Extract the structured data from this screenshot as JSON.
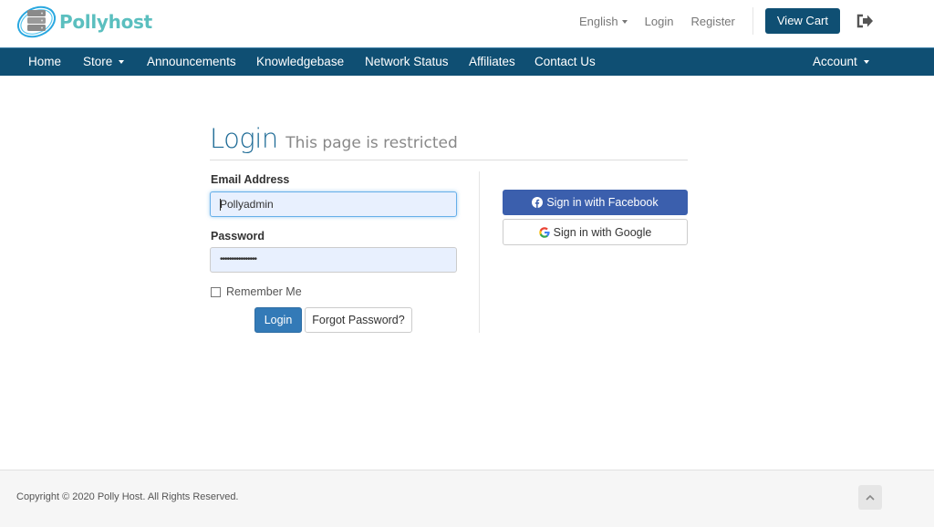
{
  "brand": {
    "name": "Pollyhost",
    "color": "#5bbfbf"
  },
  "top_links": {
    "language": "English",
    "login": "Login",
    "register": "Register",
    "view_cart": "View Cart"
  },
  "nav": {
    "items": [
      {
        "label": "Home"
      },
      {
        "label": "Store",
        "dropdown": true
      },
      {
        "label": "Announcements"
      },
      {
        "label": "Knowledgebase"
      },
      {
        "label": "Network Status"
      },
      {
        "label": "Affiliates"
      },
      {
        "label": "Contact Us"
      }
    ],
    "account": "Account",
    "color": "#0f4f73"
  },
  "login": {
    "title": "Login",
    "subtitle": "This page is restricted",
    "email_label": "Email Address",
    "email_value": "Pollyadmin",
    "password_label": "Password",
    "password_value": "••••••••••••••••",
    "remember_label": "Remember Me",
    "remember_checked": false,
    "login_button": "Login",
    "forgot_button": "Forgot Password?",
    "facebook_button": "Sign in with Facebook",
    "google_button": "Sign in with Google"
  },
  "footer": {
    "copyright": "Copyright © 2020 Polly Host. All Rights Reserved."
  }
}
